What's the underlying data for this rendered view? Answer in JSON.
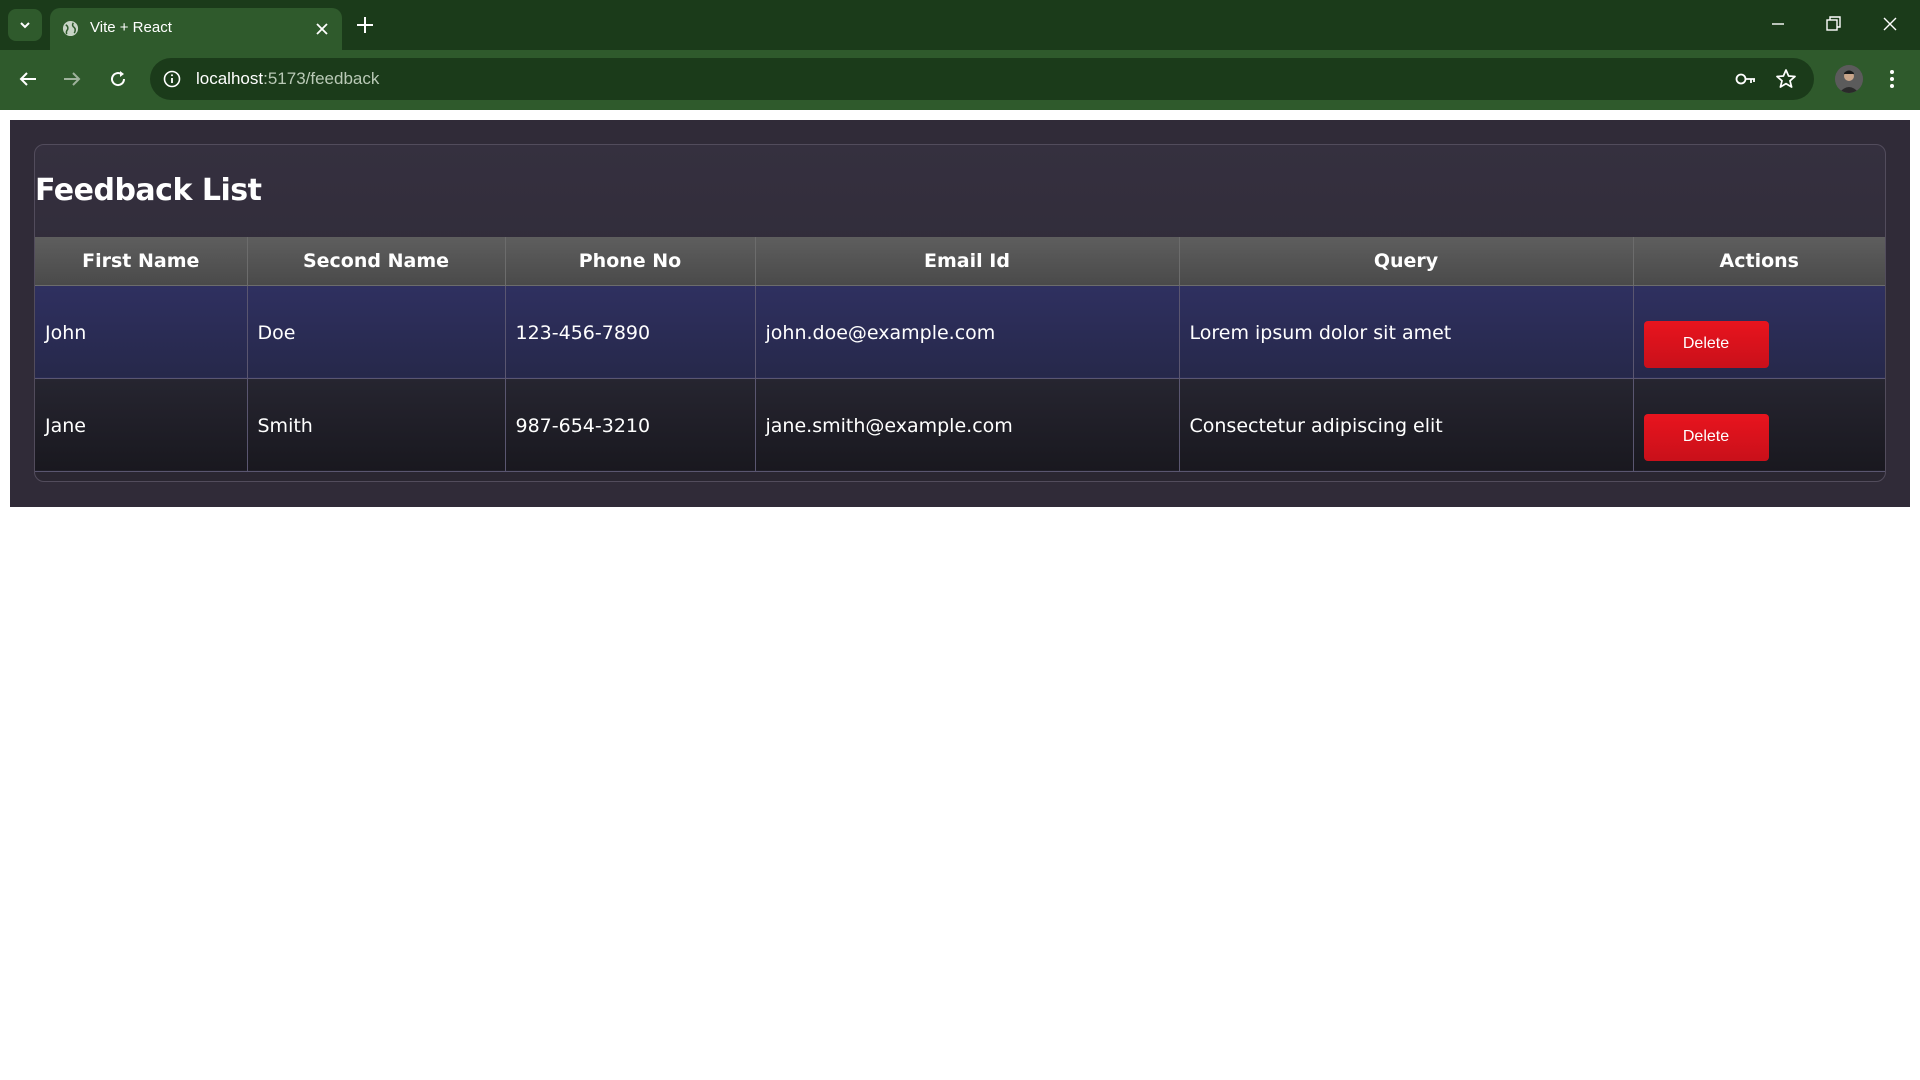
{
  "browser": {
    "tab_title": "Vite + React",
    "url_host": "localhost",
    "url_path": ":5173/feedback",
    "icons": [
      "tab-search-icon",
      "globe-favicon-icon",
      "close-icon",
      "plus-icon",
      "minimize-icon",
      "restore-icon",
      "window-close-icon",
      "back-arrow-icon",
      "forward-arrow-icon",
      "reload-icon",
      "info-icon",
      "key-icon",
      "star-icon",
      "profile-avatar",
      "more-vert-icon"
    ],
    "colors": {
      "tabbar": "#1b3b1a",
      "toolbar": "#2f5a2c"
    }
  },
  "page": {
    "title": "Feedback List",
    "columns": [
      "First Name",
      "Second Name",
      "Phone No",
      "Email Id",
      "Query",
      "Actions"
    ],
    "rows": [
      {
        "first": "John",
        "second": "Doe",
        "phone": "123-456-7890",
        "email": "john.doe@example.com",
        "query": "Lorem ipsum dolor sit amet",
        "action": "Delete"
      },
      {
        "first": "Jane",
        "second": "Smith",
        "phone": "987-654-3210",
        "email": "jane.smith@example.com",
        "query": "Consectetur adipiscing elit",
        "action": "Delete"
      }
    ],
    "colors": {
      "delete_button": "#e8141e",
      "header_bg": "#555555"
    }
  }
}
